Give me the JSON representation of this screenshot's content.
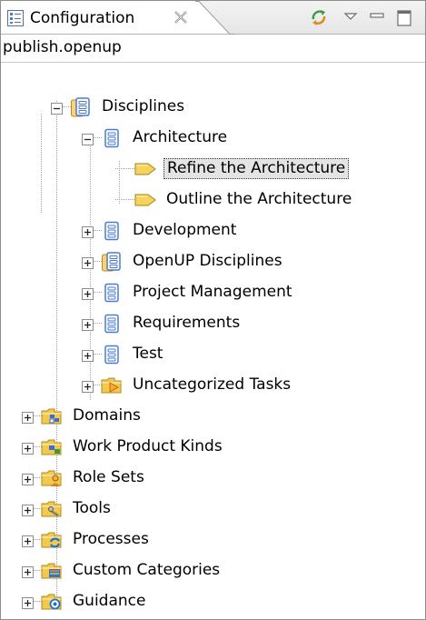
{
  "view": {
    "title": "Configuration",
    "icon": "configuration-view-icon",
    "close_icon": "close-icon",
    "toolbar": [
      {
        "name": "sync-icon"
      },
      {
        "name": "view-menu-icon"
      },
      {
        "name": "minimize-icon"
      },
      {
        "name": "maximize-icon"
      }
    ]
  },
  "path": "publish.openup",
  "tree": [
    {
      "label": "Disciplines",
      "icon": "discipline-group-icon",
      "expander": "minus"
    },
    {
      "label": "Architecture",
      "icon": "discipline-icon",
      "expander": "minus"
    },
    {
      "label": "Refine the Architecture",
      "icon": "task-icon",
      "expander": "none",
      "selected": true
    },
    {
      "label": "Outline the Architecture",
      "icon": "task-icon",
      "expander": "none"
    },
    {
      "label": "Development",
      "icon": "discipline-icon",
      "expander": "plus"
    },
    {
      "label": "OpenUP Disciplines",
      "icon": "discipline-group-icon",
      "expander": "plus"
    },
    {
      "label": "Project Management",
      "icon": "discipline-icon",
      "expander": "plus"
    },
    {
      "label": "Requirements",
      "icon": "discipline-icon",
      "expander": "plus"
    },
    {
      "label": "Test",
      "icon": "discipline-icon",
      "expander": "plus"
    },
    {
      "label": "Uncategorized Tasks",
      "icon": "uncategorized-folder-icon",
      "expander": "plus"
    },
    {
      "label": "Domains",
      "icon": "domain-folder-icon",
      "expander": "plus"
    },
    {
      "label": "Work Product Kinds",
      "icon": "work-product-kind-folder-icon",
      "expander": "plus"
    },
    {
      "label": "Role Sets",
      "icon": "role-set-folder-icon",
      "expander": "plus"
    },
    {
      "label": "Tools",
      "icon": "tools-folder-icon",
      "expander": "plus"
    },
    {
      "label": "Processes",
      "icon": "processes-folder-icon",
      "expander": "plus"
    },
    {
      "label": "Custom Categories",
      "icon": "custom-categories-folder-icon",
      "expander": "plus"
    },
    {
      "label": "Guidance",
      "icon": "guidance-folder-icon",
      "expander": "plus"
    }
  ],
  "colors": {
    "selection_bg": "#e4e4e4",
    "folder": "#f2c94c",
    "discipline": "#4a7bd0",
    "task": "#f6d35a"
  }
}
